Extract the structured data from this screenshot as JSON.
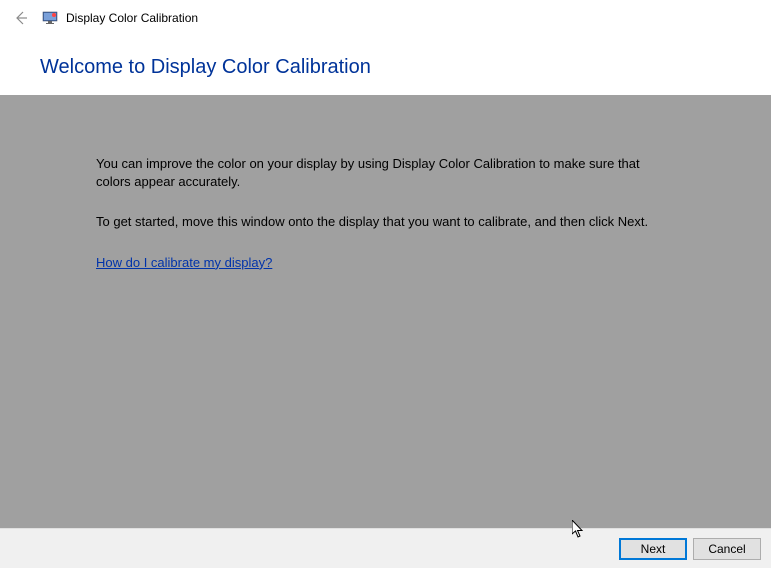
{
  "header": {
    "app_title": "Display Color Calibration"
  },
  "main": {
    "heading": "Welcome to Display Color Calibration",
    "paragraph1": "You can improve the color on your display by using Display Color Calibration to make sure that colors appear accurately.",
    "paragraph2": "To get started, move this window onto the display that you want to calibrate, and then click Next.",
    "help_link": "How do I calibrate my display?"
  },
  "footer": {
    "next_label": "Next",
    "cancel_label": "Cancel"
  },
  "colors": {
    "heading_blue": "#003399",
    "link_blue": "#0033aa",
    "content_bg": "#a0a0a0",
    "footer_bg": "#f0f0f0",
    "primary_border": "#0078d7"
  }
}
